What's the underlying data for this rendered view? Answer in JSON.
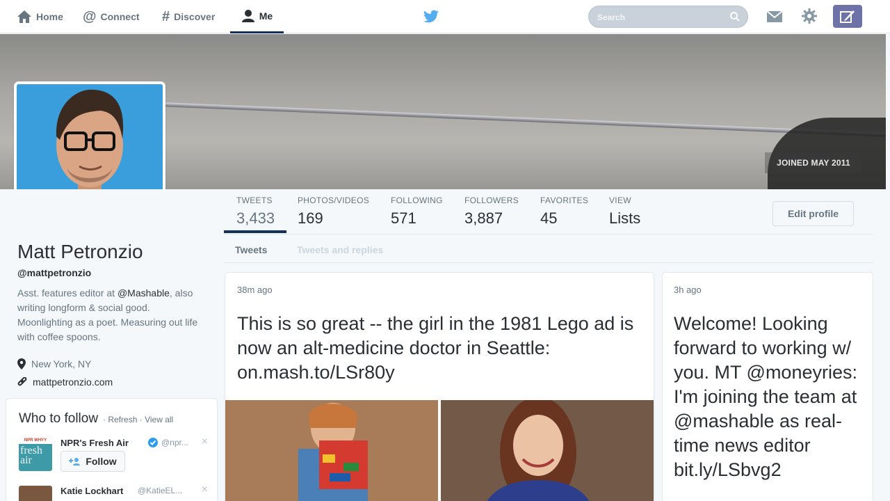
{
  "nav": {
    "items": [
      {
        "label": "Home",
        "icon": "home-icon"
      },
      {
        "label": "Connect",
        "icon": "at-icon"
      },
      {
        "label": "Discover",
        "icon": "hashtag-icon"
      },
      {
        "label": "Me",
        "icon": "person-icon"
      }
    ],
    "search_placeholder": "Search"
  },
  "header": {
    "joined": "JOINED MAY 2011"
  },
  "profile": {
    "name": "Matt Petronzio",
    "handle": "@mattpetronzio",
    "bio_1": "Asst. features editor at ",
    "bio_mention": "@Mashable",
    "bio_2": ", also writing longform & social good. Moonlighting as a poet. Measuring out life with coffee spoons.",
    "location": "New York, NY",
    "url": "mattpetronzio.com"
  },
  "stats": [
    {
      "label": "TWEETS",
      "value": "3,433"
    },
    {
      "label": "PHOTOS/VIDEOS",
      "value": "169"
    },
    {
      "label": "FOLLOWING",
      "value": "571"
    },
    {
      "label": "FOLLOWERS",
      "value": "3,887"
    },
    {
      "label": "FAVORITES",
      "value": "45"
    },
    {
      "label": "VIEW",
      "value": "Lists"
    }
  ],
  "edit_profile": "Edit profile",
  "subtabs": [
    "Tweets",
    "Tweets and replies"
  ],
  "who_to_follow": {
    "title": "Who to follow",
    "refresh": "Refresh",
    "view_all": "View all",
    "sep": "·",
    "accounts": [
      {
        "name": "NPR's Fresh Air",
        "handle": "@npr...",
        "follow": "Follow",
        "avatar_text": "fresh air",
        "avatar_top": "NPR WHYY"
      },
      {
        "name": "Katie Lockhart",
        "handle": "@KatieEL..."
      }
    ]
  },
  "tweets": [
    {
      "time": "38m ago",
      "text": "This is so great -- the girl in the 1981 Lego ad is now an alt-medicine doctor in Seattle: on.mash.to/LSr80y"
    },
    {
      "time": "3h ago",
      "text": "Welcome! Looking forward to working w/ you. MT @moneyries: I'm joining the team at @mashable as real-time news editor bit.ly/LSbvg2"
    }
  ],
  "colors": {
    "nav_active": "#14315a",
    "twitter_blue": "#55acee",
    "compose": "#6d72a7",
    "verified": "#2b9df0"
  }
}
